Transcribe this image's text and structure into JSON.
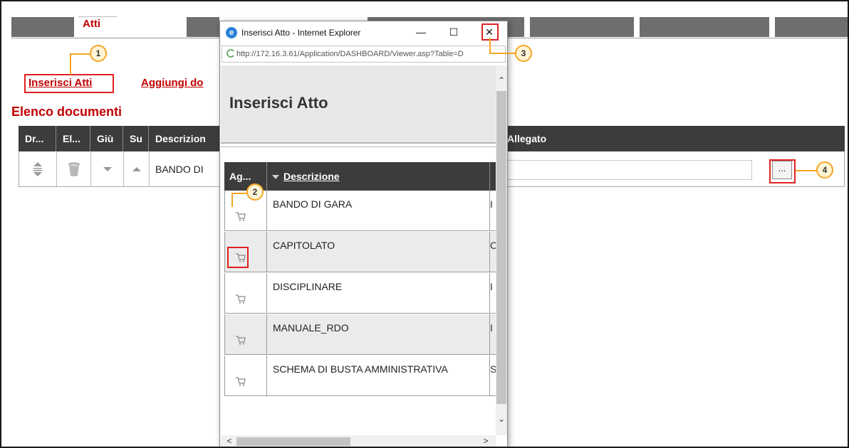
{
  "tabs": {
    "active_label": "Atti"
  },
  "links": {
    "insert_atti": "Inserisci Atti",
    "aggiungi": "Aggiungi do"
  },
  "section_title": "Elenco documenti",
  "grid": {
    "headers": [
      "Dr...",
      "El...",
      "Giù",
      "Su",
      "Descrizion",
      "Allegato"
    ],
    "row": {
      "descrizione": "BANDO DI",
      "allegato_value": "",
      "browse_label": "..."
    }
  },
  "callouts": [
    "1",
    "2",
    "3",
    "4"
  ],
  "popup": {
    "window_title": "Inserisci Atto - Internet Explorer",
    "url": "http://172.16.3.61/Application/DASHBOARD/Viewer.asp?Table=D",
    "minimize": "—",
    "maximize": "☐",
    "close": "✕",
    "heading": "Inserisci Atto",
    "table": {
      "headers": [
        "Ag...",
        "Descrizione"
      ],
      "rows": [
        {
          "descrizione": "BANDO DI GARA",
          "extra": "I"
        },
        {
          "descrizione": "CAPITOLATO",
          "extra": "C"
        },
        {
          "descrizione": "DISCIPLINARE",
          "extra": "I"
        },
        {
          "descrizione": "MANUALE_RDO",
          "extra": "I"
        },
        {
          "descrizione": "SCHEMA DI BUSTA AMMINISTRATIVA",
          "extra": "S"
        }
      ]
    }
  },
  "icons": {
    "drag": "drag-handle-icon",
    "delete": "trash-icon",
    "down": "arrow-down-icon",
    "up": "arrow-up-icon",
    "cart": "cart-icon",
    "ie": "internet-explorer-icon"
  },
  "colors": {
    "accent_red": "#c00000",
    "header_dark": "#3c3c3c",
    "callout_orange": "#f5a623",
    "highlight_red": "#e02020"
  }
}
